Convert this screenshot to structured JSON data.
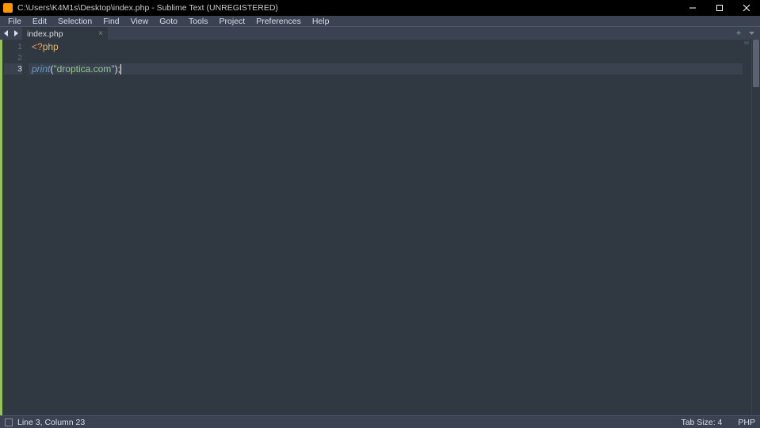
{
  "window": {
    "title": "C:\\Users\\K4M1s\\Desktop\\index.php - Sublime Text (UNREGISTERED)"
  },
  "menu": {
    "file": "File",
    "edit": "Edit",
    "selection": "Selection",
    "find": "Find",
    "view": "View",
    "goto": "Goto",
    "tools": "Tools",
    "project": "Project",
    "preferences": "Preferences",
    "help": "Help"
  },
  "tabs": {
    "active": "index.php"
  },
  "code": {
    "lines": {
      "1": {
        "num": "1",
        "open_tag": "<?",
        "php": "php"
      },
      "2": {
        "num": "2"
      },
      "3": {
        "num": "3",
        "func": "print",
        "lp": "(",
        "q1": "\"",
        "str": "droptica.com",
        "q2": "\"",
        "rp": ")",
        "semi": ";"
      }
    }
  },
  "status": {
    "line_col": "Line 3, Column 23",
    "tab_size": "Tab Size: 4",
    "syntax": "PHP"
  }
}
